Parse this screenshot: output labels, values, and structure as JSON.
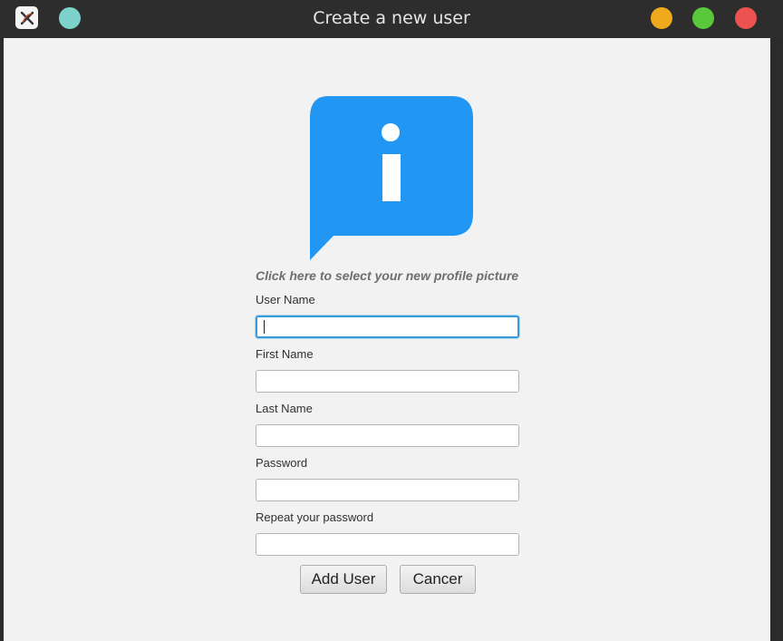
{
  "window": {
    "title": "Create a new user",
    "colors": {
      "pin": "#7dd3cc",
      "minimize": "#f0a81c",
      "maximize": "#5ac73b",
      "close": "#ec5350"
    }
  },
  "avatar": {
    "icon": "info-speech-bubble-icon",
    "color": "#2196f3",
    "caption": "Click here to select your new profile picture"
  },
  "form": {
    "fields": [
      {
        "label": "User Name",
        "value": "",
        "placeholder": ""
      },
      {
        "label": "First Name",
        "value": "",
        "placeholder": ""
      },
      {
        "label": "Last Name",
        "value": "",
        "placeholder": ""
      },
      {
        "label": "Password",
        "value": "",
        "placeholder": ""
      },
      {
        "label": "Repeat your password",
        "value": "",
        "placeholder": ""
      }
    ],
    "focus_color": "#3a9bd9"
  },
  "buttons": {
    "add_label": "Add User",
    "cancel_label": "Cancer"
  }
}
